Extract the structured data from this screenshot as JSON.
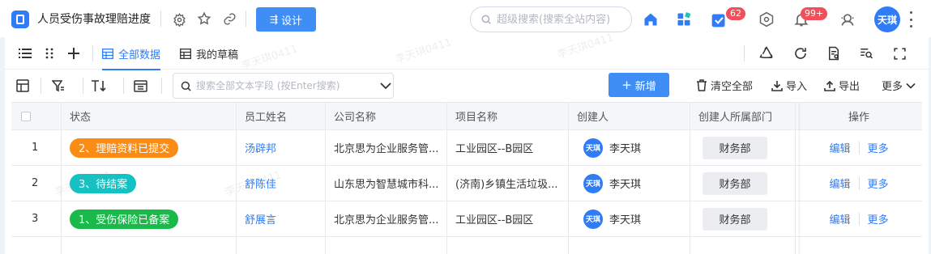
{
  "topbar": {
    "title": "人员受伤事故理赔进度",
    "design_label": "设计",
    "search_placeholder": "超级搜索(搜索全站内容)",
    "todo_badge": "62",
    "notify_badge": "99+",
    "avatar_text": "天琪",
    "accent": "#2f7cf6",
    "badge_color": "#f0505a"
  },
  "views": {
    "all_label": "全部数据",
    "draft_label": "我的草稿"
  },
  "toolbar": {
    "search_placeholder": "搜索全部文本字段 (按Enter搜索)",
    "add_label": "新增",
    "clear_label": "清空全部",
    "import_label": "导入",
    "export_label": "导出",
    "more_label": "更多"
  },
  "table": {
    "headers": {
      "status": "状态",
      "employee": "员工姓名",
      "company": "公司名称",
      "project": "项目名称",
      "creator": "创建人",
      "dept": "创建人所属部门",
      "ops": "操作"
    },
    "edit_label": "编辑",
    "more_label": "更多",
    "rows": [
      {
        "index": "1",
        "status": "2、理赔资料已提交",
        "status_color": "#fa8c16",
        "employee": "汤辟邦",
        "company": "北京思为企业服务管...",
        "project": "工业园区--B园区",
        "creator_avatar": "天琪",
        "creator": "李天琪",
        "dept": "财务部"
      },
      {
        "index": "2",
        "status": "3、待结案",
        "status_color": "#13c2c2",
        "employee": "舒陈佳",
        "company": "山东思为智慧城市科...",
        "project": "(济南)乡镇生活垃圾...",
        "creator_avatar": "天琪",
        "creator": "李天琪",
        "dept": "财务部"
      },
      {
        "index": "3",
        "status": "1、受伤保险已备案",
        "status_color": "#1aba4a",
        "employee": "舒展言",
        "company": "北京思为企业服务管...",
        "project": "工业园区--B园区",
        "creator_avatar": "天琪",
        "creator": "李天琪",
        "dept": "财务部"
      }
    ]
  },
  "watermark": "李天琪0411"
}
